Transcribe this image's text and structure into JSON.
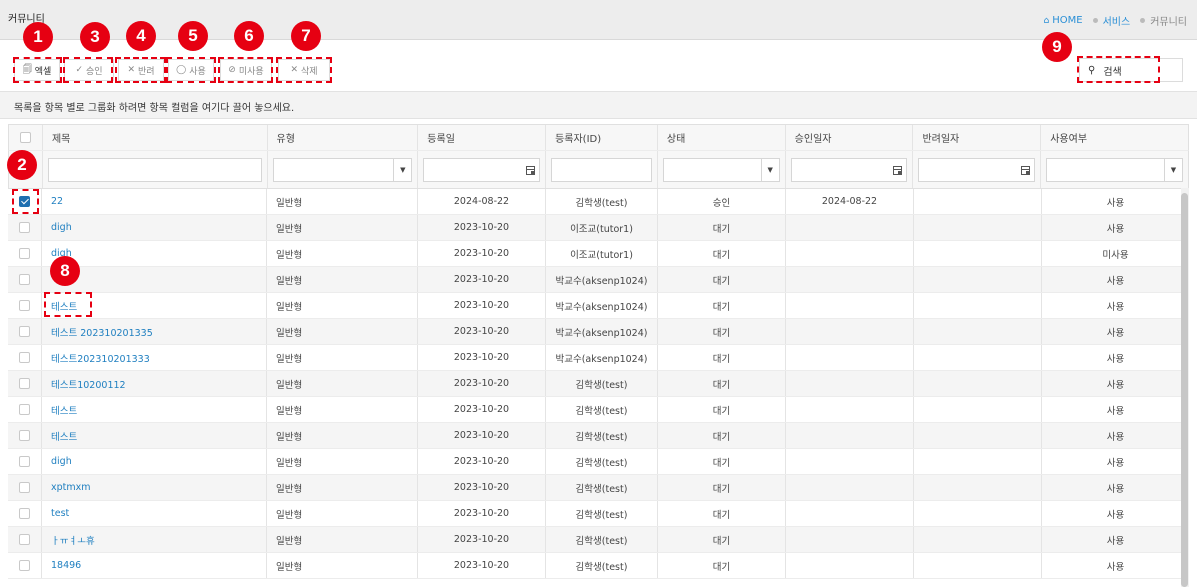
{
  "app": {
    "title": "커뮤니티"
  },
  "breadcrumb": [
    "HOME",
    "서비스",
    "커뮤니티"
  ],
  "toolbar": {
    "excel": "엑셀",
    "approve": "승인",
    "reject": "반려",
    "use": "사용",
    "unuse": "미사용",
    "delete": "삭제"
  },
  "search": {
    "label": "검색"
  },
  "grid": {
    "group_hint": "목록을 항목 별로 그룹화 하려면 항목 컬럼을 여기다 끌어 놓으세요.",
    "columns": [
      "제목",
      "유형",
      "등록일",
      "등록자(ID)",
      "상태",
      "승인일자",
      "반려일자",
      "사용여부"
    ],
    "rows": [
      {
        "checked": true,
        "title": "22",
        "type": "일반형",
        "reg_date": "2024-08-22",
        "author": "김학생(test)",
        "status": "승인",
        "approve_date": "2024-08-22",
        "reject_date": "",
        "use": "사용"
      },
      {
        "checked": false,
        "title": "digh",
        "type": "일반형",
        "reg_date": "2023-10-20",
        "author": "이조교(tutor1)",
        "status": "대기",
        "approve_date": "",
        "reject_date": "",
        "use": "사용"
      },
      {
        "checked": false,
        "title": "digh",
        "type": "일반형",
        "reg_date": "2023-10-20",
        "author": "이조교(tutor1)",
        "status": "대기",
        "approve_date": "",
        "reject_date": "",
        "use": "미사용"
      },
      {
        "checked": false,
        "title": "",
        "type": "일반형",
        "reg_date": "2023-10-20",
        "author": "박교수(aksenp1024)",
        "status": "대기",
        "approve_date": "",
        "reject_date": "",
        "use": "사용"
      },
      {
        "checked": false,
        "title": "테스트",
        "type": "일반형",
        "reg_date": "2023-10-20",
        "author": "박교수(aksenp1024)",
        "status": "대기",
        "approve_date": "",
        "reject_date": "",
        "use": "사용"
      },
      {
        "checked": false,
        "title": "테스트 202310201335",
        "type": "일반형",
        "reg_date": "2023-10-20",
        "author": "박교수(aksenp1024)",
        "status": "대기",
        "approve_date": "",
        "reject_date": "",
        "use": "사용"
      },
      {
        "checked": false,
        "title": "테스트202310201333",
        "type": "일반형",
        "reg_date": "2023-10-20",
        "author": "박교수(aksenp1024)",
        "status": "대기",
        "approve_date": "",
        "reject_date": "",
        "use": "사용"
      },
      {
        "checked": false,
        "title": "테스트10200112",
        "type": "일반형",
        "reg_date": "2023-10-20",
        "author": "김학생(test)",
        "status": "대기",
        "approve_date": "",
        "reject_date": "",
        "use": "사용"
      },
      {
        "checked": false,
        "title": "테스트",
        "type": "일반형",
        "reg_date": "2023-10-20",
        "author": "김학생(test)",
        "status": "대기",
        "approve_date": "",
        "reject_date": "",
        "use": "사용"
      },
      {
        "checked": false,
        "title": "테스트",
        "type": "일반형",
        "reg_date": "2023-10-20",
        "author": "김학생(test)",
        "status": "대기",
        "approve_date": "",
        "reject_date": "",
        "use": "사용"
      },
      {
        "checked": false,
        "title": "digh",
        "type": "일반형",
        "reg_date": "2023-10-20",
        "author": "김학생(test)",
        "status": "대기",
        "approve_date": "",
        "reject_date": "",
        "use": "사용"
      },
      {
        "checked": false,
        "title": "xptmxm",
        "type": "일반형",
        "reg_date": "2023-10-20",
        "author": "김학생(test)",
        "status": "대기",
        "approve_date": "",
        "reject_date": "",
        "use": "사용"
      },
      {
        "checked": false,
        "title": "test",
        "type": "일반형",
        "reg_date": "2023-10-20",
        "author": "김학생(test)",
        "status": "대기",
        "approve_date": "",
        "reject_date": "",
        "use": "사용"
      },
      {
        "checked": false,
        "title": "ㅏㅠㅕㅗ휴",
        "type": "일반형",
        "reg_date": "2023-10-20",
        "author": "김학생(test)",
        "status": "대기",
        "approve_date": "",
        "reject_date": "",
        "use": "사용"
      },
      {
        "checked": false,
        "title": "18496",
        "type": "일반형",
        "reg_date": "2023-10-20",
        "author": "김학생(test)",
        "status": "대기",
        "approve_date": "",
        "reject_date": "",
        "use": "사용"
      }
    ]
  },
  "annotations": [
    "1",
    "2",
    "3",
    "4",
    "5",
    "6",
    "7",
    "8",
    "9"
  ],
  "colors": {
    "annotation": "#e60012",
    "link": "#1f7fc0",
    "accent": "#2a8fd6"
  }
}
